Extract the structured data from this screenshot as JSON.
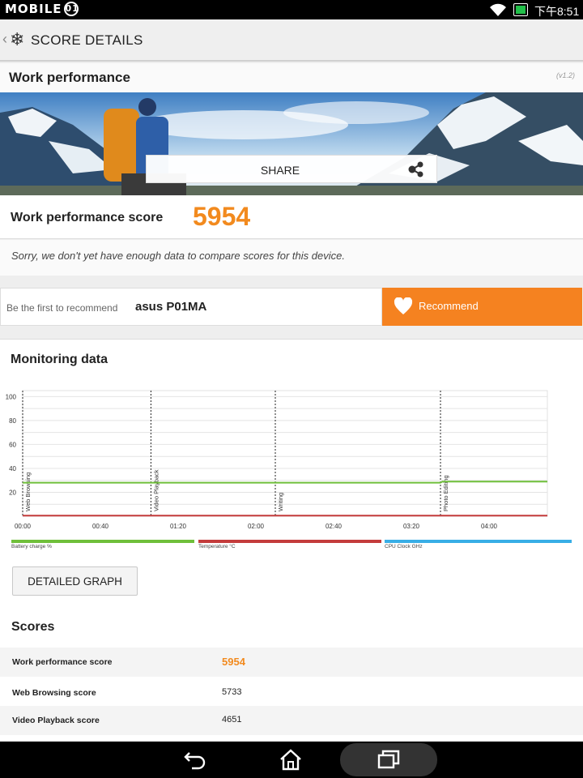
{
  "statusbar": {
    "brand": "MOBILE",
    "brand_badge": "01",
    "time": "下午8:51"
  },
  "appbar": {
    "title": "SCORE DETAILS"
  },
  "section": {
    "title": "Work performance",
    "version": "(v1.2)"
  },
  "share": {
    "label": "SHARE"
  },
  "score": {
    "label": "Work performance score",
    "value": "5954"
  },
  "sorry_text": "Sorry, we don't yet have enough data to compare scores for this device.",
  "recommend": {
    "prefix": "Be the first to recommend",
    "device": "asus P01MA",
    "button": "Recommend"
  },
  "monitoring": {
    "title": "Monitoring data"
  },
  "legend": [
    {
      "label": "Battery charge %",
      "color": "#6fbf3a"
    },
    {
      "label": "Temperature °C",
      "color": "#c43c3c"
    },
    {
      "label": "CPU Clock GHz",
      "color": "#38aee6"
    }
  ],
  "chart_data": {
    "type": "line",
    "x_tick_labels": [
      "00:00",
      "00:40",
      "01:20",
      "02:00",
      "02:40",
      "03:20",
      "04:00"
    ],
    "x_tick_minutes": [
      0,
      40,
      80,
      120,
      160,
      200,
      240
    ],
    "xlim": [
      0,
      270
    ],
    "ylim": [
      0,
      105
    ],
    "y_ticks": [
      20,
      40,
      60,
      80,
      100
    ],
    "grid": true,
    "phases": [
      {
        "label": "Web Browsing",
        "start": 0
      },
      {
        "label": "Video Playback",
        "start": 66
      },
      {
        "label": "Writing",
        "start": 130
      },
      {
        "label": "Photo Editing",
        "start": 215
      }
    ],
    "series": [
      {
        "name": "Battery charge %",
        "color": "#6fbf3a",
        "x": [
          0,
          215,
          216,
          270
        ],
        "y": [
          28,
          28,
          29,
          29
        ]
      },
      {
        "name": "Temperature °C",
        "color": "#c43c3c",
        "x": [
          0,
          270
        ],
        "y": [
          0.5,
          0.5
        ]
      }
    ]
  },
  "detailed_graph": {
    "label": "DETAILED GRAPH"
  },
  "scores": {
    "title": "Scores",
    "rows": [
      {
        "name": "Work performance score",
        "value": "5954"
      },
      {
        "name": "Web Browsing score",
        "value": "5733"
      },
      {
        "name": "Video Playback score",
        "value": "4651"
      }
    ]
  }
}
